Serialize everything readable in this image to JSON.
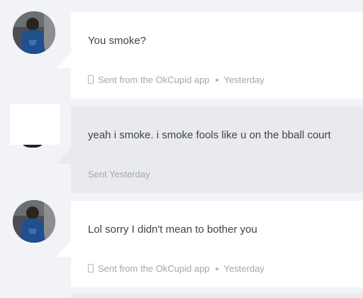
{
  "thread": {
    "messages": [
      {
        "direction": "incoming",
        "text": "You smoke?",
        "source": "Sent from the OkCupid app",
        "time": "Yesterday",
        "avatar": "profile-photo"
      },
      {
        "direction": "outgoing",
        "text": "yeah i smoke. i smoke fools like u on the bball court",
        "status": "Sent Yesterday",
        "avatar": "hidden-profile-photo"
      },
      {
        "direction": "incoming",
        "text": "Lol sorry I didn't mean to bother you",
        "source": "Sent from the OkCupid app",
        "time": "Yesterday",
        "avatar": "profile-photo"
      }
    ]
  },
  "colors": {
    "background": "#f2f3f7",
    "incoming_bubble": "#ffffff",
    "outgoing_bubble": "#e9eaef",
    "message_text": "#3f4349",
    "meta_text": "#a3a7af"
  },
  "icons": {
    "device": "phone-icon",
    "separator": "dot-separator"
  }
}
